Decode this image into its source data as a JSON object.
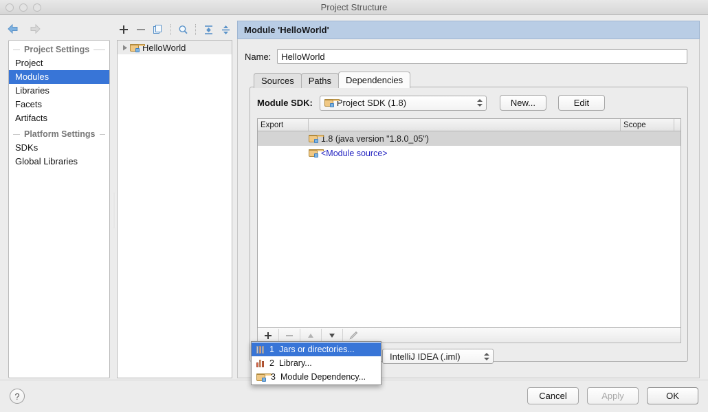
{
  "window": {
    "title": "Project Structure"
  },
  "nav_toolbar": {
    "back_icon": "arrow-left-icon",
    "forward_icon": "arrow-right-icon"
  },
  "sidebar": {
    "groups": [
      {
        "title": "Project Settings",
        "items": [
          {
            "label": "Project",
            "selected": false
          },
          {
            "label": "Modules",
            "selected": true
          },
          {
            "label": "Libraries",
            "selected": false
          },
          {
            "label": "Facets",
            "selected": false
          },
          {
            "label": "Artifacts",
            "selected": false
          }
        ]
      },
      {
        "title": "Platform Settings",
        "items": [
          {
            "label": "SDKs",
            "selected": false
          },
          {
            "label": "Global Libraries",
            "selected": false
          }
        ]
      }
    ]
  },
  "tree_toolbar": {
    "add_label": "+",
    "remove_label": "−",
    "copy_icon": "copy-icon",
    "search_icon": "search-icon",
    "expand_icon": "expand-all-icon",
    "collapse_icon": "collapse-all-icon"
  },
  "module_tree": {
    "rows": [
      {
        "label": "HelloWorld",
        "icon": "module-folder-icon",
        "expander": "▶"
      }
    ]
  },
  "detail": {
    "header": "Module 'HelloWorld'",
    "name_label": "Name:",
    "name_value": "HelloWorld",
    "name_placeholder": "",
    "tabs": [
      {
        "label": "Sources",
        "active": false
      },
      {
        "label": "Paths",
        "active": false
      },
      {
        "label": "Dependencies",
        "active": true
      }
    ],
    "sdk": {
      "label": "Module SDK:",
      "value": "Project SDK (1.8)",
      "new_button": "New...",
      "edit_button": "Edit"
    },
    "table": {
      "columns": [
        "Export",
        "",
        "Scope"
      ],
      "rows": [
        {
          "export": "",
          "name": "1.8 (java version \"1.8.0_05\")",
          "scope": "",
          "icon": "sdk-folder-icon",
          "selected": true,
          "link": false
        },
        {
          "export": "",
          "name": "<Module source>",
          "scope": "",
          "icon": "module-source-icon",
          "selected": false,
          "link": true
        }
      ]
    },
    "table_toolbar": {
      "add": "+",
      "remove": "−",
      "move_up": "▲",
      "move_down": "▼",
      "edit": "✎"
    },
    "storage": {
      "value": "IntelliJ IDEA (.iml)"
    }
  },
  "popup_menu": {
    "items": [
      {
        "num": "1",
        "label": "Jars or directories...",
        "icon": "jars-icon",
        "highlighted": true
      },
      {
        "num": "2",
        "label": "Library...",
        "icon": "library-icon",
        "highlighted": false
      },
      {
        "num": "3",
        "label": "Module Dependency...",
        "icon": "module-folder-icon",
        "highlighted": false
      }
    ]
  },
  "footer": {
    "help_label": "?",
    "cancel_label": "Cancel",
    "apply_label": "Apply",
    "ok_label": "OK"
  },
  "colors": {
    "selection_blue": "#3875d7",
    "header_blue": "#b9cde5",
    "window_bg": "#ececec",
    "link_blue": "#2323c0"
  }
}
